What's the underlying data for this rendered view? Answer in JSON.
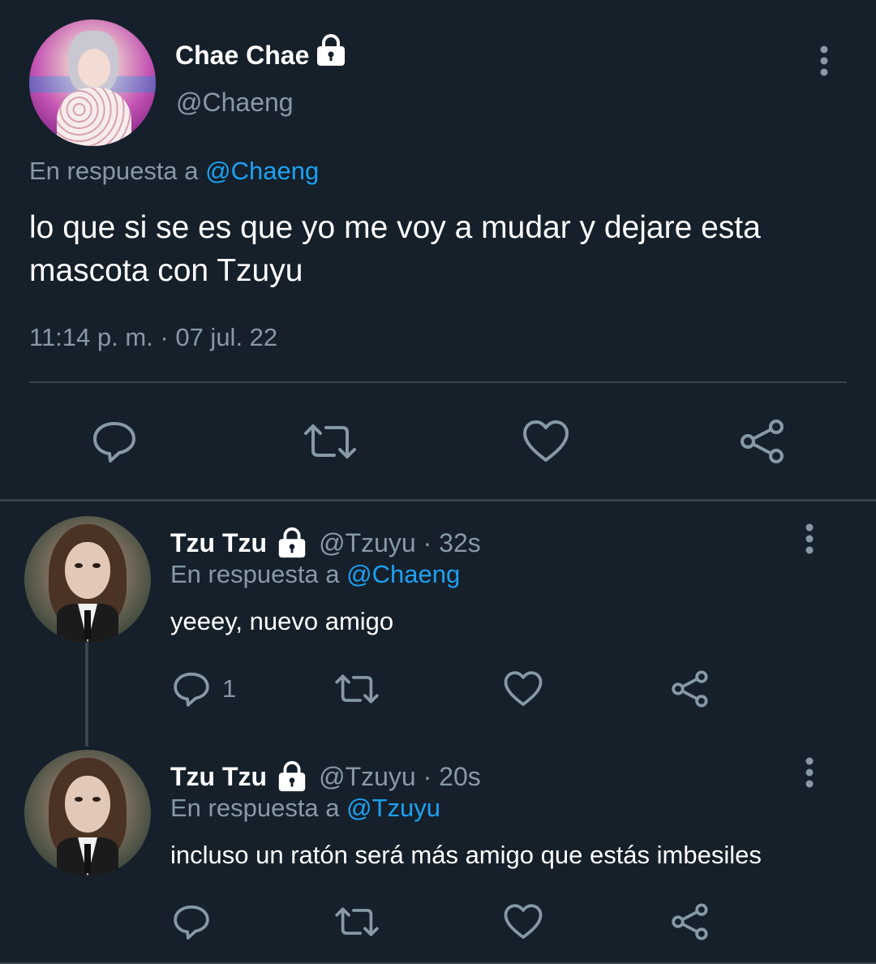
{
  "main_tweet": {
    "display_name": "Chae Chae",
    "handle": "@Chaeng",
    "reply_prefix": "En respuesta a",
    "reply_mention": "@Chaeng",
    "text": "lo que si se es que yo me voy a mudar y dejare esta mascota con Tzuyu",
    "timestamp": "11:14 p. m. · 07 jul. 22",
    "locked": true
  },
  "replies": [
    {
      "display_name": "Tzu Tzu",
      "handle_time": "@Tzuyu · 32s",
      "reply_prefix": "En respuesta a",
      "reply_mention": "@Chaeng",
      "text": "yeeey, nuevo amigo",
      "reply_count": "1",
      "locked": true
    },
    {
      "display_name": "Tzu Tzu",
      "handle_time": "@Tzuyu · 20s",
      "reply_prefix": "En respuesta a",
      "reply_mention": "@Tzuyu",
      "text": "incluso un ratón será más amigo que estás imbesiles",
      "reply_count": "",
      "locked": true
    }
  ],
  "icons": [
    "lock-icon",
    "more-vertical-icon",
    "reply-icon",
    "retweet-icon",
    "like-icon",
    "share-icon"
  ],
  "colors": {
    "background": "#15202b",
    "text": "#ffffff",
    "secondary": "#8899a6",
    "link": "#1da1f2",
    "divider": "#38444d"
  }
}
